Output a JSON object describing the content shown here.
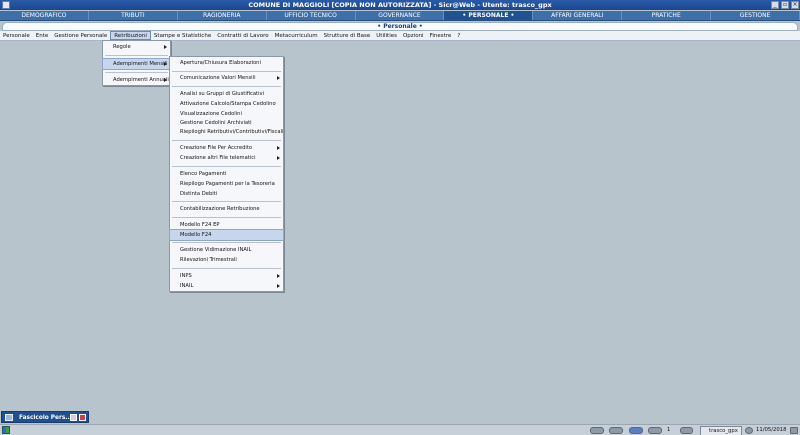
{
  "window": {
    "title": "COMUNE DI MAGGIOLI [COPIA NON AUTORIZZATA]  - Sicr@Web  - Utente: trasco_gpx"
  },
  "modules": [
    {
      "label": "DEMOGRAFICO"
    },
    {
      "label": "TRIBUTI"
    },
    {
      "label": "RAGIONERIA"
    },
    {
      "label": "UFFICIO TECNICO"
    },
    {
      "label": "GOVERNANCE"
    },
    {
      "label": "• PERSONALE •"
    },
    {
      "label": "AFFARI GENERALI"
    },
    {
      "label": "PRATICHE"
    },
    {
      "label": "GESTIONE"
    }
  ],
  "section_title": "• Personale •",
  "menubar": [
    {
      "label": "Personale"
    },
    {
      "label": "Ente"
    },
    {
      "label": "Gestione Personale"
    },
    {
      "label": "Retribuzioni"
    },
    {
      "label": "Stampe e Statistiche"
    },
    {
      "label": "Contratti di Lavoro"
    },
    {
      "label": "Metacurriculum"
    },
    {
      "label": "Strutture di Base"
    },
    {
      "label": "Utilities"
    },
    {
      "label": "Opzioni"
    },
    {
      "label": "Finestre"
    },
    {
      "label": "?"
    }
  ],
  "retribuzioni_menu": [
    {
      "label": "Regole"
    },
    {
      "label": "Adempimenti Mensili"
    },
    {
      "label": "Adempimenti Annuali"
    }
  ],
  "adempimenti_mensili_menu": [
    {
      "label": "Apertura/Chiusura Elaborazioni"
    },
    {
      "label": "Comunicazione Valori Mensili"
    },
    {
      "label": "Analisi su Gruppi di Giustificativi"
    },
    {
      "label": "Attivazione Calcolo/Stampa Cedolino"
    },
    {
      "label": "Visualizzazione Cedolini"
    },
    {
      "label": "Gestione Cedolini Archiviati"
    },
    {
      "label": "Riepiloghi Retributivi/Contributivi/Fiscali"
    },
    {
      "label": "Creazione File Per Accredito"
    },
    {
      "label": "Creazione altri File telematici"
    },
    {
      "label": "Elenco Pagamenti"
    },
    {
      "label": "Riepilogo Pagamenti per la Tesoreria"
    },
    {
      "label": "Distinta Debiti"
    },
    {
      "label": "Contabilizzazione Retribuzione"
    },
    {
      "label": "Modello F24 EP"
    },
    {
      "label": "Modello F24"
    },
    {
      "label": "Gestione Vidimazione INAIL"
    },
    {
      "label": "Rilevazioni Trimestrali"
    },
    {
      "label": "INPS"
    },
    {
      "label": "INAIL"
    }
  ],
  "taskbar": {
    "open_window": "Fascicolo Pers...",
    "tray_count": "1",
    "tray_user": "trasco_gpx",
    "date": "11/05/2018"
  }
}
